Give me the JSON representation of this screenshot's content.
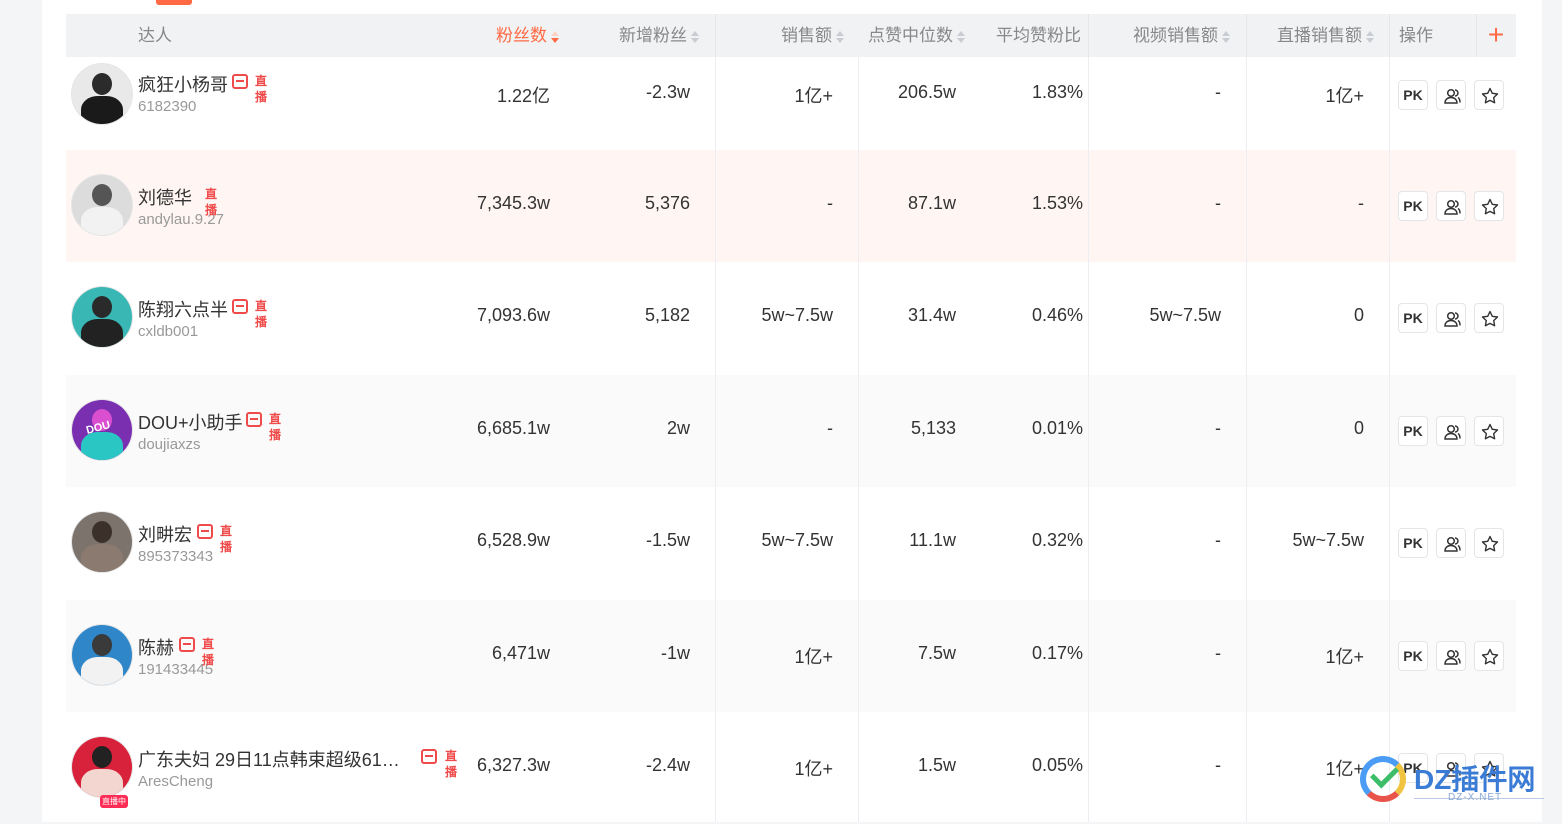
{
  "colors": {
    "accent": "#ff6a45",
    "badge_red": "#f04b4b",
    "header_bg": "#f1f2f4",
    "row_highlight": "#fff6f3"
  },
  "header": {
    "creator": "达人",
    "followers": "粉丝数",
    "new_followers": "新增粉丝",
    "sales": "销售额",
    "median_likes": "点赞中位数",
    "avg_like_ratio": "平均赞粉比",
    "video_sales": "视频销售额",
    "live_sales": "直播销售额",
    "actions": "操作",
    "add_column": "+"
  },
  "ops": {
    "pk_label": "PK",
    "compare_icon": "users-icon",
    "favorite_icon": "star-icon"
  },
  "live_badge_text": "直播",
  "live_now_tag": "直播中",
  "rows": [
    {
      "name": "疯狂小杨哥",
      "uid": "6182390",
      "followers": "1.22亿",
      "new_followers": "-2.3w",
      "sales": "1亿+",
      "median_likes": "206.5w",
      "avg_like_ratio": "1.83%",
      "video_sales": "-",
      "live_sales": "1亿+"
    },
    {
      "name": "刘德华",
      "uid": "andylau.9.27",
      "followers": "7,345.3w",
      "new_followers": "5,376",
      "sales": "-",
      "median_likes": "87.1w",
      "avg_like_ratio": "1.53%",
      "video_sales": "-",
      "live_sales": "-"
    },
    {
      "name": "陈翔六点半",
      "uid": "cxldb001",
      "followers": "7,093.6w",
      "new_followers": "5,182",
      "sales": "5w~7.5w",
      "median_likes": "31.4w",
      "avg_like_ratio": "0.46%",
      "video_sales": "5w~7.5w",
      "live_sales": "0"
    },
    {
      "name": "DOU+小助手",
      "uid": "doujiaxzs",
      "followers": "6,685.1w",
      "new_followers": "2w",
      "sales": "-",
      "median_likes": "5,133",
      "avg_like_ratio": "0.01%",
      "video_sales": "-",
      "live_sales": "0",
      "avatar_text": "DOU"
    },
    {
      "name": "刘畊宏",
      "uid": "895373343",
      "followers": "6,528.9w",
      "new_followers": "-1.5w",
      "sales": "5w~7.5w",
      "median_likes": "11.1w",
      "avg_like_ratio": "0.32%",
      "video_sales": "-",
      "live_sales": "5w~7.5w"
    },
    {
      "name": "陈赫",
      "uid": "191433445",
      "followers": "6,471w",
      "new_followers": "-1w",
      "sales": "1亿+",
      "median_likes": "7.5w",
      "avg_like_ratio": "0.17%",
      "video_sales": "-",
      "live_sales": "1亿+"
    },
    {
      "name": "广东夫妇 29日11点韩束超级618...",
      "uid": "AresCheng",
      "followers": "6,327.3w",
      "new_followers": "-2.4w",
      "sales": "1亿+",
      "median_likes": "1.5w",
      "avg_like_ratio": "0.05%",
      "video_sales": "-",
      "live_sales": "1亿+"
    }
  ],
  "watermark": {
    "text": "DZ插件网",
    "sub": "DZ-X.NET"
  }
}
